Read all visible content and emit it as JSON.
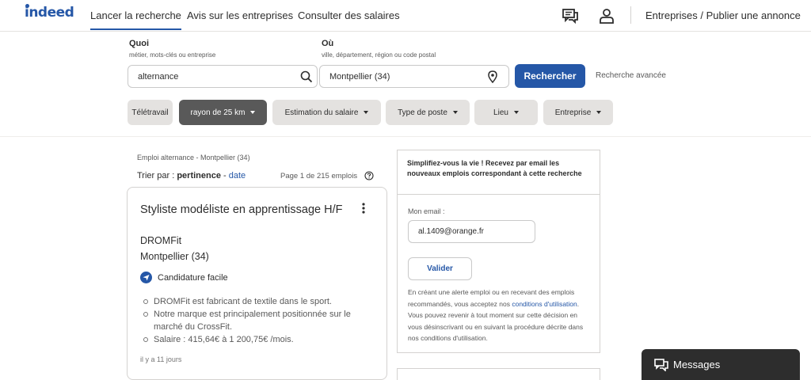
{
  "brand": {
    "logo_text": "indeed",
    "accent_color": "#2557a7"
  },
  "nav": {
    "tabs": [
      {
        "label": "Lancer la recherche",
        "active": true
      },
      {
        "label": "Avis sur les entreprises",
        "active": false
      },
      {
        "label": "Consulter des salaires",
        "active": false
      }
    ],
    "icons": [
      "messages-icon",
      "profile-icon"
    ],
    "employers_link": "Entreprises / Publier une annonce"
  },
  "search": {
    "what": {
      "label": "Quoi",
      "hint": "métier, mots-clés ou entreprise",
      "value": "alternance",
      "icon": "search-icon"
    },
    "where": {
      "label": "Où",
      "hint": "ville, département, région ou code postal",
      "value": "Montpellier (34)",
      "icon": "location-pin-icon"
    },
    "submit_label": "Rechercher",
    "advanced_label": "Recherche avancée"
  },
  "filters": [
    {
      "label": "Télétravail",
      "dropdown": false,
      "active": false
    },
    {
      "label": "rayon de 25 km",
      "dropdown": true,
      "active": true
    },
    {
      "label": "Estimation du salaire",
      "dropdown": true,
      "active": false
    },
    {
      "label": "Type de poste",
      "dropdown": true,
      "active": false
    },
    {
      "label": "Lieu",
      "dropdown": true,
      "active": false
    },
    {
      "label": "Entreprise",
      "dropdown": true,
      "active": false
    }
  ],
  "results": {
    "breadcrumb": "Emploi alternance - Montpellier (34)",
    "sort_prefix": "Trier par :",
    "sort_active": "pertinence",
    "sort_separator": "-",
    "sort_other": "date",
    "page_info": "Page 1 de 215 emplois",
    "jobs": [
      {
        "title": "Styliste modéliste en apprentissage H/F",
        "company": "DROMFit",
        "location": "Montpellier (34)",
        "easy_apply": "Candidature facile",
        "snippet": [
          "DROMFit est fabricant de textile dans le sport.",
          "Notre marque est principalement positionnée sur le marché du CrossFit.",
          "Salaire : 415,64€ à 1 200,75€ /mois."
        ],
        "posted": "il y a 11 jours"
      }
    ]
  },
  "alert": {
    "heading": "Simplifiez-vous la vie ! Recevez par email les nouveaux emplois correspondant à cette recherche",
    "email_label": "Mon email :",
    "email_value": "al.1409@orange.fr",
    "submit_label": "Valider",
    "legal_before": "En créant une alerte emploi ou en recevant des emplois recommandés, vous acceptez nos ",
    "legal_link": "conditions d'utilisation",
    "legal_after": ". Vous pouvez revenir à tout moment sur cette décision en vous désinscrivant ou en suivant la procédure décrite dans nos conditions d'utilisation."
  },
  "messages": {
    "label": "Messages"
  }
}
